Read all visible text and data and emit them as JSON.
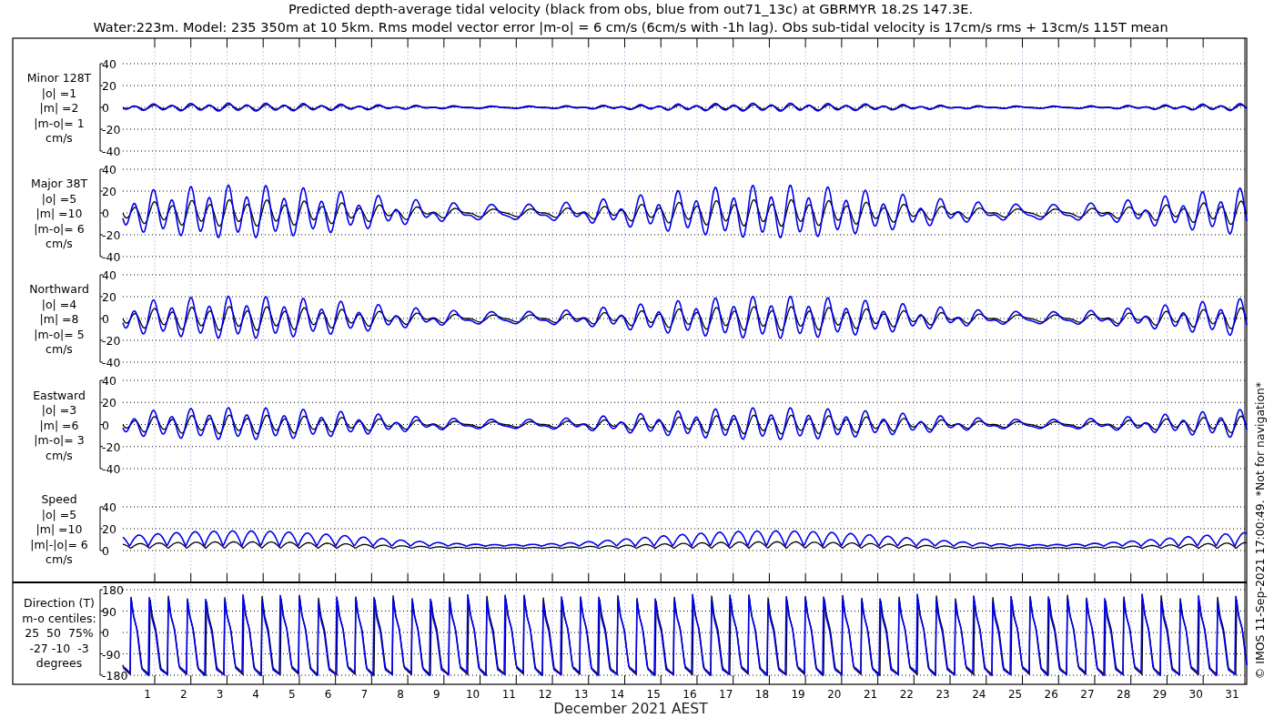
{
  "title_lines": [
    "Predicted depth-average tidal velocity (black from obs, blue from out71_13c) at GBRMYR 18.2S 147.3E.",
    "Water:223m. Model: 235 350m at 10 5km. Rms model vector error |m-o| = 6 cm/s (6cm/s with -1h lag). Obs sub-tidal velocity is 17cm/s rms + 13cm/s 115T mean"
  ],
  "panels": [
    {
      "kind": "velocity",
      "label_lines": [
        "Minor 128T",
        "|o| =1",
        "|m| =2",
        "|m-o|= 1",
        "cm/s"
      ],
      "yticks": [
        "40",
        "20",
        "0",
        "-20",
        "-40"
      ]
    },
    {
      "kind": "velocity",
      "label_lines": [
        "Major 38T",
        "|o| =5",
        "|m| =10",
        "|m-o|= 6",
        "cm/s"
      ],
      "yticks": [
        "40",
        "20",
        "0",
        "-20",
        "-40"
      ]
    },
    {
      "kind": "velocity",
      "label_lines": [
        "Northward",
        "|o| =4",
        "|m| =8",
        "|m-o|= 5",
        "cm/s"
      ],
      "yticks": [
        "40",
        "20",
        "0",
        "-20",
        "-40"
      ]
    },
    {
      "kind": "velocity",
      "label_lines": [
        "Eastward",
        "|o| =3",
        "|m| =6",
        "|m-o|= 3",
        "cm/s"
      ],
      "yticks": [
        "40",
        "20",
        "0",
        "-20",
        "-40"
      ]
    },
    {
      "kind": "speed",
      "label_lines": [
        "Speed",
        "|o| =5",
        "|m| =10",
        "|m|-|o|= 6",
        "cm/s"
      ],
      "yticks": [
        "40",
        "20",
        "0"
      ]
    },
    {
      "kind": "direction",
      "label_lines": [
        "Direction (T)",
        "m-o centiles:",
        "25  50  75%",
        "-27 -10  -3",
        "degrees"
      ],
      "yticks": [
        "180",
        "90",
        "0",
        "-90",
        "-180"
      ]
    }
  ],
  "x_labels": [
    "1",
    "2",
    "3",
    "4",
    "5",
    "6",
    "7",
    "8",
    "9",
    "10",
    "11",
    "12",
    "13",
    "14",
    "15",
    "16",
    "17",
    "18",
    "19",
    "20",
    "21",
    "22",
    "23",
    "24",
    "25",
    "26",
    "27",
    "28",
    "29",
    "30",
    "31"
  ],
  "xlabel": "December 2021 AEST",
  "credit": "© IMOS 11-Sep-2021 17:00:49. *Not for navigation*"
}
